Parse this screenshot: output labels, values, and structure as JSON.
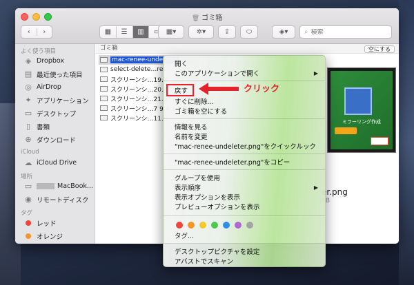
{
  "window": {
    "title": "ゴミ箱"
  },
  "toolbar": {
    "back": "‹",
    "forward": "›",
    "search_placeholder": "検索"
  },
  "sidebar": {
    "sections": [
      {
        "heading": "よく使う項目",
        "items": [
          {
            "label": "Dropbox",
            "icon": "dropbox-icon"
          },
          {
            "label": "最近使った項目",
            "icon": "recents-icon"
          },
          {
            "label": "AirDrop",
            "icon": "airdrop-icon"
          },
          {
            "label": "アプリケーション",
            "icon": "applications-icon"
          },
          {
            "label": "デスクトップ",
            "icon": "desktop-icon"
          },
          {
            "label": "書類",
            "icon": "documents-icon"
          },
          {
            "label": "ダウンロード",
            "icon": "downloads-icon"
          }
        ]
      },
      {
        "heading": "iCloud",
        "items": [
          {
            "label": "iCloud Drive",
            "icon": "cloud-icon"
          }
        ]
      },
      {
        "heading": "場所",
        "items": [
          {
            "label": "MacBook...",
            "icon": "laptop-icon"
          },
          {
            "label": "リモートディスク",
            "icon": "disc-icon"
          }
        ]
      },
      {
        "heading": "タグ",
        "items": [
          {
            "label": "レッド",
            "color": "#f0453a"
          },
          {
            "label": "オレンジ",
            "color": "#f5962b"
          }
        ]
      }
    ]
  },
  "content": {
    "path_label": "ゴミ箱",
    "empty_button": "空にする",
    "files": [
      {
        "name": "mac-renee-undeleter",
        "selected": true
      },
      {
        "name": "select-delete…rec",
        "selected": false
      },
      {
        "name": "スクリーンシ…19.3",
        "selected": false
      },
      {
        "name": "スクリーンシ…20.3",
        "selected": false
      },
      {
        "name": "スクリーンシ…21.0",
        "selected": false
      },
      {
        "name": "スクリーンシ…7 9.4",
        "selected": false
      },
      {
        "name": "スクリーンシ…11.0",
        "selected": false
      }
    ],
    "preview_filename": "er.png",
    "preview_size": "KB",
    "preview_label": "ミラーリング作成"
  },
  "context_menu": {
    "open": "開く",
    "open_with": "このアプリケーションで開く",
    "put_back": "戻す",
    "delete_immediately": "すぐに削除...",
    "empty_trash": "ゴミ箱を空にする",
    "get_info": "情報を見る",
    "rename": "名前を変更",
    "quick_look": "\"mac-renee-undeleter.png\"をクイックルック",
    "copy": "\"mac-renee-undeleter.png\"をコピー",
    "use_groups": "グループを使用",
    "sort_by": "表示順序",
    "show_view_options": "表示オプションを表示",
    "show_preview_options": "プレビューオプションを表示",
    "tag_colors": [
      "#f0453a",
      "#f5962b",
      "#f5c92b",
      "#4cc94a",
      "#2f8de6",
      "#b264d8",
      "#a4a4a4"
    ],
    "tags": "タグ...",
    "set_desktop_picture": "デスクトップピクチャを設定",
    "scan_with_avast": "アバストでスキャン"
  },
  "annotation": {
    "callout_text": "クリック",
    "accent_color": "#e4232b"
  }
}
